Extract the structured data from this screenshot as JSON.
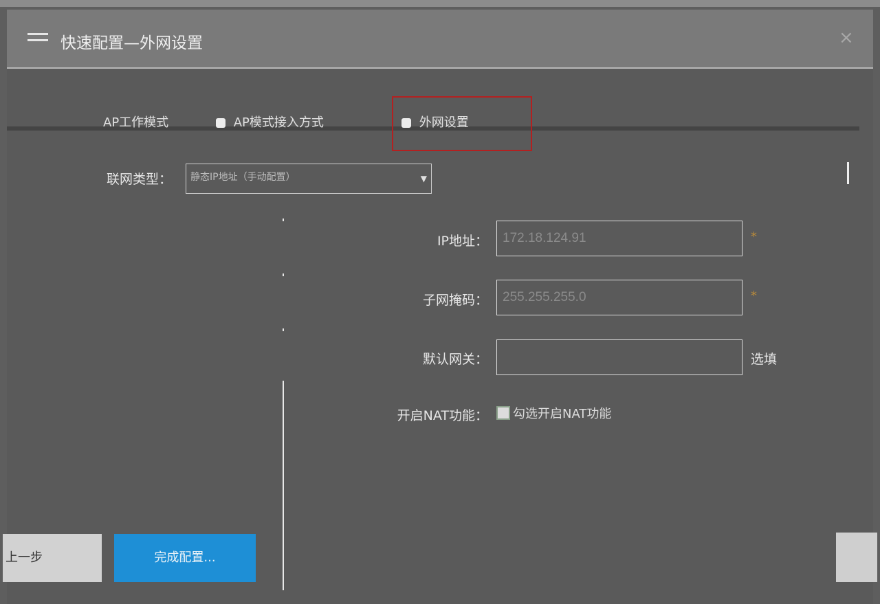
{
  "dialog": {
    "title": "快速配置—外网设置",
    "close_label": "×"
  },
  "steps": [
    {
      "label": "AP工作模式"
    },
    {
      "label": "AP模式接入方式"
    },
    {
      "label": "外网设置"
    }
  ],
  "form": {
    "link_type_label": "联网类型：",
    "link_type_value": "静态IP地址（手动配置）",
    "ip_label": "IP地址：",
    "ip_value": "172.18.124.91",
    "mask_label": "子网掩码：",
    "mask_value": "255.255.255.0",
    "gateway_label": "默认网关：",
    "gateway_value": "",
    "required_mark": "*",
    "optional_label": "选填",
    "nat_label": "开启NAT功能：",
    "nat_checkbox_text": "勾选开启NAT功能"
  },
  "buttons": {
    "prev_label": "上一步",
    "finish_label": "完成配置..."
  },
  "colors": {
    "accent": "#1e8fd6",
    "highlight_border": "#b42020"
  }
}
